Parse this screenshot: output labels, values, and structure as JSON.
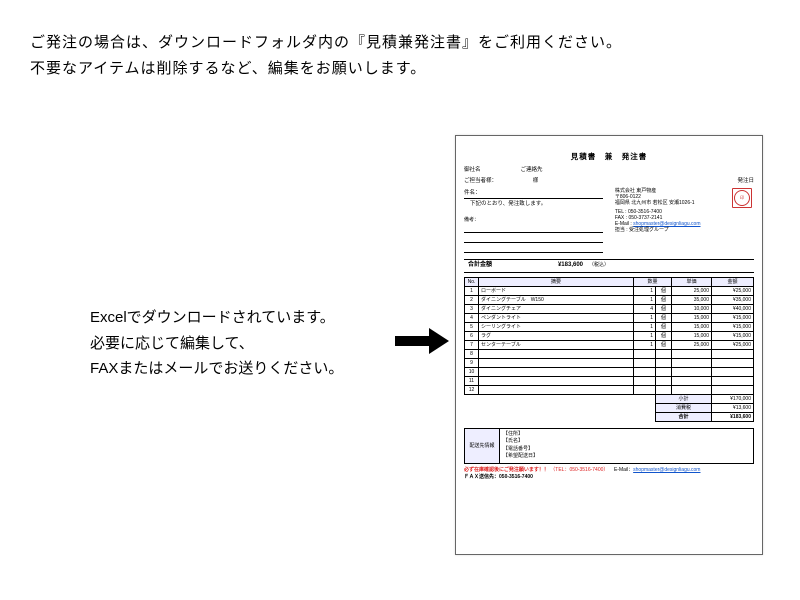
{
  "top": {
    "line1": "ご発注の場合は、ダウンロードフォルダ内の『見積兼発注書』をご利用ください。",
    "line2": "不要なアイテムは削除するなど、編集をお願いします。"
  },
  "mid": {
    "line1": "Excelでダウンロードされています。",
    "line2": "必要に応じて編集して、",
    "line3": "FAXまたはメールでお送りください。"
  },
  "doc": {
    "title": "見積書　兼　発注書",
    "fields": {
      "company_label": "御社名",
      "contact_label": "ご連絡先",
      "person_label": "ご担当者様：",
      "person_suffix": "様",
      "date_label": "発注日",
      "subject_label": "件名：",
      "subject_text": "下記のとおり、発注致します。",
      "remark": "備考："
    },
    "supplier": {
      "name": "株式会社 東戸物産",
      "zip": "〒806-0122",
      "addr": "福岡県 北九州市 若松区 安瀬1026-1",
      "tel_label": "TEL :",
      "tel": "050-3516-7400",
      "fax_label": "FAX :",
      "fax": "050-3737-2141",
      "mail_label": "E-Mail :",
      "mail": "shopmaster@designliagu.com",
      "group_label": "担当 :",
      "group": "受注処理グループ"
    },
    "grand": {
      "label": "合計金額",
      "value": "¥183,600",
      "tax": "（税込）"
    },
    "headers": {
      "no": "No.",
      "name": "摘要",
      "qty": "数量",
      "unit": "",
      "price": "単価",
      "amount": "金額"
    },
    "items": [
      {
        "no": "1",
        "name": "ローボード",
        "qty": "1",
        "unit": "個",
        "price": "25,000",
        "amount": "¥25,000"
      },
      {
        "no": "2",
        "name": "ダイニングテーブル　W150",
        "qty": "1",
        "unit": "個",
        "price": "35,000",
        "amount": "¥35,000"
      },
      {
        "no": "3",
        "name": "ダイニングチェア",
        "qty": "4",
        "unit": "個",
        "price": "10,000",
        "amount": "¥40,000"
      },
      {
        "no": "4",
        "name": "ペンダントライト",
        "qty": "1",
        "unit": "個",
        "price": "15,000",
        "amount": "¥15,000"
      },
      {
        "no": "5",
        "name": "シーリングライト",
        "qty": "1",
        "unit": "個",
        "price": "15,000",
        "amount": "¥15,000"
      },
      {
        "no": "6",
        "name": "ラグ",
        "qty": "1",
        "unit": "個",
        "price": "15,000",
        "amount": "¥15,000"
      },
      {
        "no": "7",
        "name": "センターテーブル",
        "qty": "1",
        "unit": "個",
        "price": "25,000",
        "amount": "¥25,000"
      },
      {
        "no": "8",
        "name": "",
        "qty": "",
        "unit": "",
        "price": "",
        "amount": ""
      },
      {
        "no": "9",
        "name": "",
        "qty": "",
        "unit": "",
        "price": "",
        "amount": ""
      },
      {
        "no": "10",
        "name": "",
        "qty": "",
        "unit": "",
        "price": "",
        "amount": ""
      },
      {
        "no": "11",
        "name": "",
        "qty": "",
        "unit": "",
        "price": "",
        "amount": ""
      },
      {
        "no": "12",
        "name": "",
        "qty": "",
        "unit": "",
        "price": "",
        "amount": ""
      }
    ],
    "summary": {
      "subtotal_label": "小計",
      "subtotal": "¥170,000",
      "tax_label": "消費税",
      "tax": "¥13,600",
      "total_label": "合計",
      "total": "¥183,600"
    },
    "delivery": {
      "label": "配送先情報",
      "addr": "【住所】",
      "name": "【氏名】",
      "phone": "【電話番号】",
      "wish": "【希望配送日】"
    },
    "footer": {
      "warn": "必ず在庫確認後にご発注願います！！",
      "tel_l": "（TEL：",
      "tel": "050-3516-7400",
      "tel_r": "）",
      "mail_l": "E-Mail：",
      "mail": "shopmaster@designliagu.com",
      "fax_l": "ＦＡＸ送信先：",
      "fax": "050-3516-7400"
    }
  }
}
